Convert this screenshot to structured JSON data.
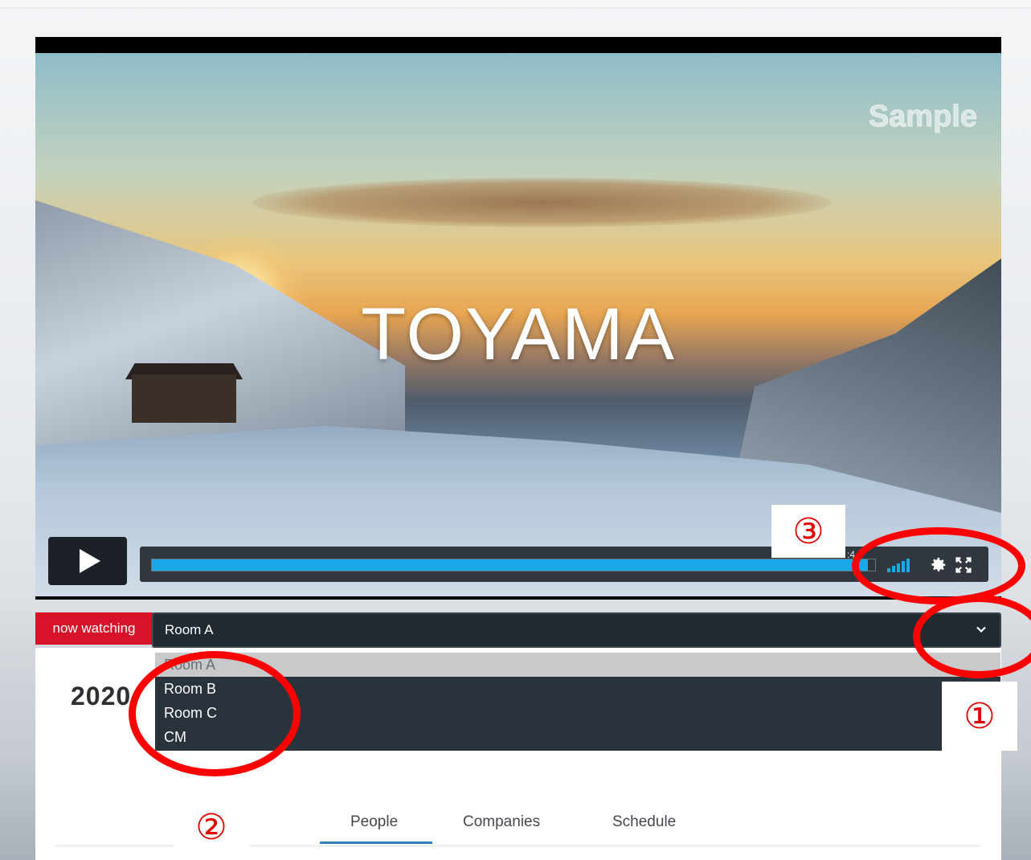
{
  "video": {
    "title_overlay": "TOYAMA",
    "watermark": "Sample",
    "time_fragment": ":4",
    "progress_percent": 99
  },
  "controls": {
    "play_icon": "play-icon",
    "quality_icon": "signal-bars-icon",
    "settings_icon": "gear-icon",
    "fullscreen_icon": "fullscreen-icon"
  },
  "room_selector": {
    "label": "now watching",
    "selected": "Room A",
    "options": [
      "Room A",
      "Room B",
      "Room C",
      "CM"
    ]
  },
  "page": {
    "year_fragment": "2020"
  },
  "tabs": [
    "People",
    "Companies",
    "Schedule"
  ],
  "annotations": {
    "marker_1": "①",
    "marker_2": "②",
    "marker_3": "③"
  },
  "colors": {
    "accent_blue": "#1aa9e8",
    "live_red": "#d7132a",
    "annotation_red": "#ff0000",
    "tab_active": "#2b7fc2"
  }
}
